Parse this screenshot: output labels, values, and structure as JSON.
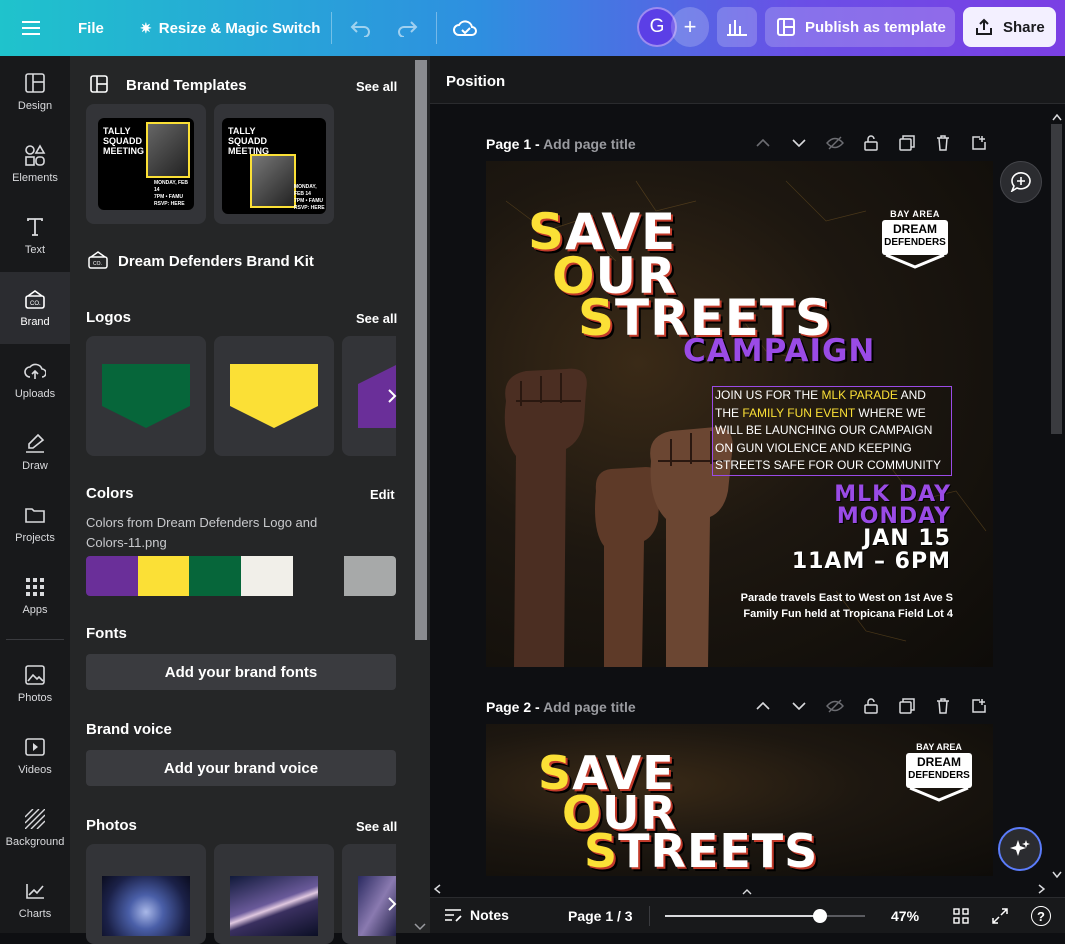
{
  "topbar": {
    "file_label": "File",
    "resize_label": "Resize & Magic Switch",
    "avatar_letter": "G",
    "publish_label": "Publish as template",
    "share_label": "Share"
  },
  "rail": {
    "items": [
      {
        "label": "Design",
        "icon": "layout-icon"
      },
      {
        "label": "Elements",
        "icon": "shapes-icon"
      },
      {
        "label": "Text",
        "icon": "text-icon"
      },
      {
        "label": "Brand",
        "icon": "brand-icon"
      },
      {
        "label": "Uploads",
        "icon": "cloud-upload-icon"
      },
      {
        "label": "Draw",
        "icon": "pen-icon"
      },
      {
        "label": "Projects",
        "icon": "folder-icon"
      },
      {
        "label": "Apps",
        "icon": "apps-grid-icon"
      },
      {
        "label": "Photos",
        "icon": "image-icon"
      },
      {
        "label": "Videos",
        "icon": "video-icon"
      },
      {
        "label": "Background",
        "icon": "hatch-icon"
      },
      {
        "label": "Charts",
        "icon": "chart-icon"
      }
    ]
  },
  "panel": {
    "brand_templates_title": "Brand Templates",
    "see_all": "See all",
    "brand_kit_title": "Dream Defenders Brand Kit",
    "logos_title": "Logos",
    "colors_title": "Colors",
    "colors_edit": "Edit",
    "colors_source": "Colors from Dream Defenders Logo and Colors-11.png",
    "swatches": [
      "#6a2f99",
      "#fbe036",
      "#06663a",
      "#f1efe9",
      "#252627",
      "#a7a9a9"
    ],
    "fonts_title": "Fonts",
    "fonts_button": "Add your brand fonts",
    "voice_title": "Brand voice",
    "voice_button": "Add your brand voice",
    "photos_title": "Photos",
    "template_thumb": {
      "line1": "TALLY",
      "line2": "SQUADD",
      "line3": "MEETING",
      "date": "MONDAY, FEB 14",
      "time": "7PM • FAMU",
      "rsvp": "RSVP: HERE"
    }
  },
  "canvas": {
    "position_label": "Position",
    "page1_label": "Page 1 - ",
    "page2_label": "Page 2 - ",
    "page_title_placeholder": "Add page title",
    "poster": {
      "s_letter": "S",
      "save_rest": "AVE",
      "o_letter": "O",
      "our_rest": "UR",
      "s2_letter": "S",
      "streets_rest": "TREETS",
      "campaign": "CAMPAIGN",
      "logo_top": "BAY AREA",
      "logo_main1": "DREAM",
      "logo_main2": "DEFENDERS",
      "blurb_part1": "JOIN US FOR THE ",
      "blurb_hl1": "MLK PARADE",
      "blurb_part2": " AND THE ",
      "blurb_hl2": "FAMILY FUN EVENT",
      "blurb_part3": " WHERE WE WILL BE LAUNCHING OUR CAMPAIGN ON GUN VIOLENCE AND KEEPING STREETS SAFE FOR OUR COMMUNITY",
      "mlk_day": "MLK DAY",
      "monday": "MONDAY",
      "jan": "JAN 15",
      "hours": "11AM – 6PM",
      "route1": "Parade travels East to West on 1st Ave S",
      "route2": "Family Fun held at Tropicana Field Lot 4"
    }
  },
  "bottombar": {
    "notes_label": "Notes",
    "page_counter": "Page 1 / 3",
    "zoom_percent": 47,
    "zoom_label": "47%"
  }
}
